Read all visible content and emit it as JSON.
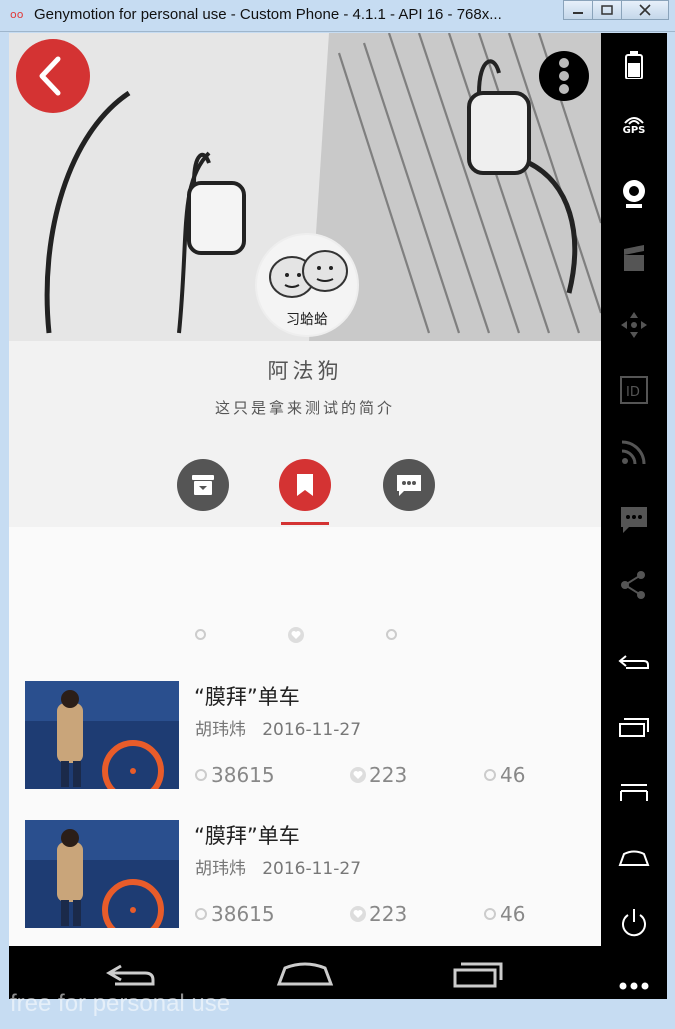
{
  "window": {
    "app_icon": "oo",
    "title": "Genymotion for personal use - Custom Phone - 4.1.1 - API 16 - 768x...",
    "buttons": [
      "minimize-icon",
      "maximize-icon",
      "close-icon"
    ],
    "watermark": "free for personal use"
  },
  "header": {
    "avatar_caption": "习蛤蛤",
    "back_icon": "chevron-left-icon",
    "more_icon": "more-vert-icon"
  },
  "profile": {
    "name": "阿法狗",
    "bio": "这只是拿来测试的简介"
  },
  "tabs": [
    {
      "icon": "archive-icon",
      "active": false
    },
    {
      "icon": "bookmark-icon",
      "active": true
    },
    {
      "icon": "chat-icon",
      "active": false
    }
  ],
  "feed": [
    {
      "title": "“膜拜”单车",
      "author": "胡玮炜",
      "date": "2016-11-27",
      "views": "38615",
      "likes": "223",
      "comments": "46"
    },
    {
      "title": "“膜拜”单车",
      "author": "胡玮炜",
      "date": "2016-11-27",
      "views": "38615",
      "likes": "223",
      "comments": "46"
    }
  ],
  "sidebar": {
    "icons": [
      "battery-icon",
      "gps-icon",
      "webcam-icon",
      "video-icon",
      "dpad-icon",
      "id-icon",
      "rss-icon",
      "sms-icon",
      "share-icon",
      "back-icon",
      "recent-apps-icon",
      "menu-icon",
      "home-icon",
      "power-icon",
      "more-horiz-icon"
    ],
    "gps_label": "GPS",
    "id_label": "ID"
  },
  "colors": {
    "accent": "#d43333",
    "dark_icon": "#555555"
  }
}
